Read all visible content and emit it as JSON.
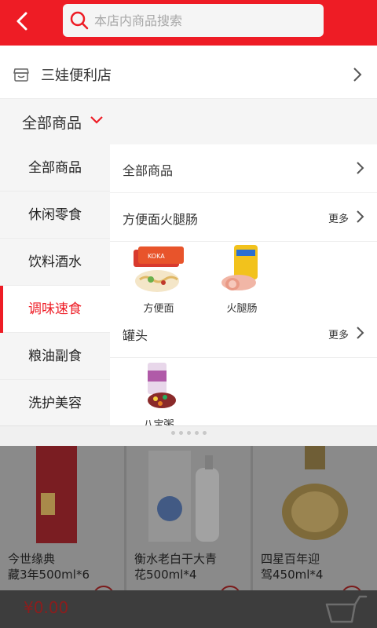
{
  "header": {
    "search_placeholder": "本店内商品搜索"
  },
  "store": {
    "name": "三娃便利店"
  },
  "category_bar": {
    "label": "全部商品"
  },
  "sidebar": {
    "items": [
      {
        "label": "全部商品",
        "active": false
      },
      {
        "label": "休闲零食",
        "active": false
      },
      {
        "label": "饮料酒水",
        "active": false
      },
      {
        "label": "调味速食",
        "active": true
      },
      {
        "label": "粮油副食",
        "active": false
      },
      {
        "label": "洗护美容",
        "active": false
      }
    ]
  },
  "panel": {
    "all_label": "全部商品",
    "sections": [
      {
        "title": "方便面火腿肠",
        "more": "更多",
        "products": [
          {
            "label": "方便面"
          },
          {
            "label": "火腿肠"
          }
        ]
      },
      {
        "title": "罐头",
        "more": "更多",
        "products": [
          {
            "label": "八宝粥"
          }
        ]
      }
    ]
  },
  "background_products": [
    {
      "title_line1": "今世缘典",
      "title_line2": "藏3年500ml*6"
    },
    {
      "title_line1": "衡水老白干大青",
      "title_line2": "花500ml*4"
    },
    {
      "title_line1": "四星百年迎",
      "title_line2": "驾450ml*4"
    }
  ],
  "cart": {
    "price": "¥0.00"
  },
  "colors": {
    "accent": "#ee1c25",
    "background": "#f5f5f5"
  }
}
